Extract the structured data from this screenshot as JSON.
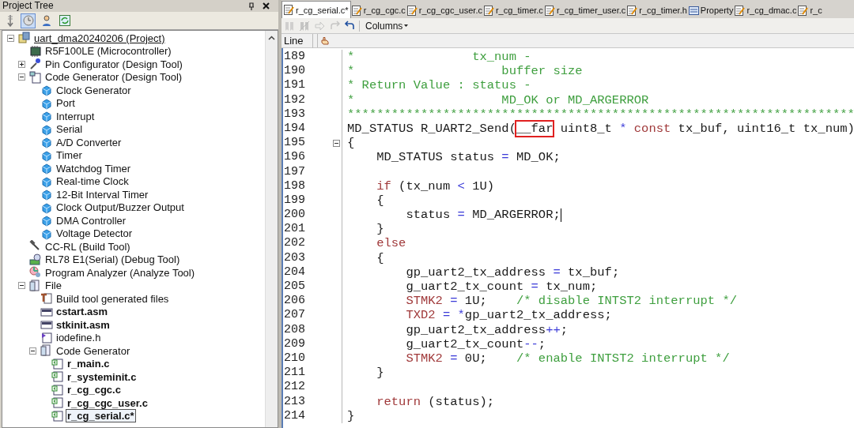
{
  "project_tree": {
    "title": "Project Tree",
    "toolbar": [
      {
        "kind": "sort",
        "selected": false
      },
      {
        "kind": "clock",
        "selected": true
      },
      {
        "kind": "person",
        "selected": false
      },
      {
        "kind": "refresh",
        "selected": false
      }
    ],
    "nodes": [
      {
        "label": "uart_dma20240206 (Project)",
        "kind": "project",
        "expanded": true,
        "bold": false,
        "selected": false,
        "children": [
          {
            "label": "R5F100LE (Microcontroller)",
            "kind": "mcu",
            "bold": false,
            "selected": false
          },
          {
            "label": "Pin Configurator (Design Tool)",
            "kind": "pin",
            "expanded": false,
            "bold": false,
            "selected": false
          },
          {
            "label": "Code Generator (Design Tool)",
            "kind": "codegen",
            "expanded": true,
            "bold": false,
            "selected": false,
            "children": [
              {
                "label": "Clock Generator",
                "kind": "peripheral",
                "bold": false,
                "selected": false
              },
              {
                "label": "Port",
                "kind": "peripheral",
                "bold": false,
                "selected": false
              },
              {
                "label": "Interrupt",
                "kind": "peripheral",
                "bold": false,
                "selected": false
              },
              {
                "label": "Serial",
                "kind": "peripheral",
                "bold": false,
                "selected": false
              },
              {
                "label": "A/D Converter",
                "kind": "peripheral",
                "bold": false,
                "selected": false
              },
              {
                "label": "Timer",
                "kind": "peripheral",
                "bold": false,
                "selected": false
              },
              {
                "label": "Watchdog Timer",
                "kind": "peripheral",
                "bold": false,
                "selected": false
              },
              {
                "label": "Real-time Clock",
                "kind": "peripheral",
                "bold": false,
                "selected": false
              },
              {
                "label": "12-Bit Interval Timer",
                "kind": "peripheral",
                "bold": false,
                "selected": false
              },
              {
                "label": "Clock Output/Buzzer Output",
                "kind": "peripheral",
                "bold": false,
                "selected": false
              },
              {
                "label": "DMA Controller",
                "kind": "peripheral",
                "bold": false,
                "selected": false
              },
              {
                "label": "Voltage Detector",
                "kind": "peripheral",
                "bold": false,
                "selected": false
              }
            ]
          },
          {
            "label": "CC-RL (Build Tool)",
            "kind": "build",
            "bold": false,
            "selected": false
          },
          {
            "label": "RL78 E1(Serial) (Debug Tool)",
            "kind": "debug",
            "bold": false,
            "selected": false
          },
          {
            "label": "Program Analyzer (Analyze Tool)",
            "kind": "analyze",
            "bold": false,
            "selected": false
          },
          {
            "label": "File",
            "kind": "folder",
            "expanded": true,
            "bold": false,
            "selected": false,
            "children": [
              {
                "label": "Build tool generated files",
                "kind": "buildfiles",
                "bold": false,
                "selected": false
              },
              {
                "label": "cstart.asm",
                "kind": "asm",
                "bold": true,
                "selected": false
              },
              {
                "label": "stkinit.asm",
                "kind": "asm",
                "bold": true,
                "selected": false
              },
              {
                "label": "iodefine.h",
                "kind": "header",
                "bold": false,
                "selected": false
              },
              {
                "label": "Code Generator",
                "kind": "folder",
                "expanded": true,
                "bold": false,
                "selected": false,
                "children": [
                  {
                    "label": "r_main.c",
                    "kind": "c",
                    "bold": true,
                    "selected": false
                  },
                  {
                    "label": "r_systeminit.c",
                    "kind": "c",
                    "bold": true,
                    "selected": false
                  },
                  {
                    "label": "r_cg_cgc.c",
                    "kind": "c",
                    "bold": true,
                    "selected": false
                  },
                  {
                    "label": "r_cg_cgc_user.c",
                    "kind": "c",
                    "bold": true,
                    "selected": false
                  },
                  {
                    "label": "r_cg_serial.c*",
                    "kind": "c",
                    "bold": true,
                    "selected": true
                  }
                ]
              }
            ]
          }
        ]
      }
    ]
  },
  "editor": {
    "tabs": [
      {
        "label": "r_cg_serial.c*",
        "kind": "file",
        "selected": true
      },
      {
        "label": "r_cg_cgc.c",
        "kind": "file",
        "selected": false
      },
      {
        "label": "r_cg_cgc_user.c",
        "kind": "file",
        "selected": false
      },
      {
        "label": "r_cg_timer.c",
        "kind": "file",
        "selected": false
      },
      {
        "label": "r_cg_timer_user.c",
        "kind": "file",
        "selected": false
      },
      {
        "label": "r_cg_timer.h",
        "kind": "file",
        "selected": false
      },
      {
        "label": "Property",
        "kind": "property",
        "selected": false
      },
      {
        "label": "r_cg_dmac.c",
        "kind": "file",
        "selected": false
      },
      {
        "label": "r_c",
        "kind": "file",
        "selected": false
      }
    ],
    "toolbar": {
      "columns_label": "Columns",
      "icons": [
        {
          "kind": "bookmark",
          "disabled": true
        },
        {
          "kind": "bookmark-clear",
          "disabled": true
        },
        {
          "kind": "forward",
          "disabled": true
        },
        {
          "kind": "redo",
          "disabled": true
        },
        {
          "kind": "undo",
          "disabled": false
        }
      ]
    },
    "header": {
      "line_label": "Line"
    },
    "lines": [
      {
        "number": "189",
        "fold": false,
        "cursor": false,
        "segments": [
          {
            "text": "*                tx_num -",
            "kind": "comment"
          }
        ]
      },
      {
        "number": "190",
        "fold": false,
        "cursor": false,
        "segments": [
          {
            "text": "*                    buffer size",
            "kind": "comment"
          }
        ]
      },
      {
        "number": "191",
        "fold": false,
        "cursor": false,
        "segments": [
          {
            "text": "* Return Value : status -",
            "kind": "comment"
          }
        ]
      },
      {
        "number": "192",
        "fold": false,
        "cursor": false,
        "segments": [
          {
            "text": "*                    MD_OK or MD_ARGERROR",
            "kind": "comment"
          }
        ]
      },
      {
        "number": "193",
        "fold": false,
        "cursor": false,
        "segments": [
          {
            "text": "*********************************************************************",
            "kind": "comment"
          }
        ]
      },
      {
        "number": "194",
        "fold": false,
        "cursor": false,
        "segments": [
          {
            "text": "MD_STATUS R_UART2_Send(",
            "kind": "plain"
          },
          {
            "text": "__far",
            "kind": "plain",
            "boxed": true
          },
          {
            "text": " uint8_t ",
            "kind": "plain"
          },
          {
            "text": "*",
            "kind": "op"
          },
          {
            "text": " const",
            "kind": "keyword"
          },
          {
            "text": " tx_buf, uint16_t tx_num)",
            "kind": "plain"
          }
        ]
      },
      {
        "number": "195",
        "fold": true,
        "cursor": false,
        "segments": [
          {
            "text": "{",
            "kind": "plain"
          }
        ]
      },
      {
        "number": "196",
        "fold": false,
        "cursor": false,
        "segments": [
          {
            "text": "    MD_STATUS status ",
            "kind": "plain"
          },
          {
            "text": "=",
            "kind": "op"
          },
          {
            "text": " MD_OK;",
            "kind": "plain"
          }
        ]
      },
      {
        "number": "197",
        "fold": false,
        "cursor": false
      },
      {
        "number": "198",
        "fold": false,
        "cursor": false,
        "segments": [
          {
            "text": "    if",
            "kind": "keyword"
          },
          {
            "text": " (tx_num ",
            "kind": "plain"
          },
          {
            "text": "<",
            "kind": "op"
          },
          {
            "text": " 1U)",
            "kind": "plain"
          }
        ]
      },
      {
        "number": "199",
        "fold": false,
        "cursor": false,
        "segments": [
          {
            "text": "    {",
            "kind": "plain"
          }
        ]
      },
      {
        "number": "200",
        "fold": false,
        "cursor": true,
        "segments": [
          {
            "text": "        status ",
            "kind": "plain"
          },
          {
            "text": "=",
            "kind": "op"
          },
          {
            "text": " MD_ARGERROR;",
            "kind": "plain"
          }
        ]
      },
      {
        "number": "201",
        "fold": false,
        "cursor": false,
        "segments": [
          {
            "text": "    }",
            "kind": "plain"
          }
        ]
      },
      {
        "number": "202",
        "fold": false,
        "cursor": false,
        "segments": [
          {
            "text": "    else",
            "kind": "keyword"
          }
        ]
      },
      {
        "number": "203",
        "fold": false,
        "cursor": false,
        "segments": [
          {
            "text": "    {",
            "kind": "plain"
          }
        ]
      },
      {
        "number": "204",
        "fold": false,
        "cursor": false,
        "segments": [
          {
            "text": "        gp_uart2_tx_address ",
            "kind": "plain"
          },
          {
            "text": "=",
            "kind": "op"
          },
          {
            "text": " tx_buf;",
            "kind": "plain"
          }
        ]
      },
      {
        "number": "205",
        "fold": false,
        "cursor": false,
        "segments": [
          {
            "text": "        g_uart2_tx_count ",
            "kind": "plain"
          },
          {
            "text": "=",
            "kind": "op"
          },
          {
            "text": " tx_num;",
            "kind": "plain"
          }
        ]
      },
      {
        "number": "206",
        "fold": false,
        "cursor": false,
        "segments": [
          {
            "text": "        STMK2",
            "kind": "keyword"
          },
          {
            "text": " =",
            "kind": "op"
          },
          {
            "text": " 1U;    ",
            "kind": "plain"
          },
          {
            "text": "/* disable INTST2 interrupt */",
            "kind": "comment"
          }
        ]
      },
      {
        "number": "207",
        "fold": false,
        "cursor": false,
        "segments": [
          {
            "text": "        TXD2",
            "kind": "keyword"
          },
          {
            "text": " = *",
            "kind": "op"
          },
          {
            "text": "gp_uart2_tx_address;",
            "kind": "plain"
          }
        ]
      },
      {
        "number": "208",
        "fold": false,
        "cursor": false,
        "segments": [
          {
            "text": "        gp_uart2_tx_address",
            "kind": "plain"
          },
          {
            "text": "++",
            "kind": "op"
          },
          {
            "text": ";",
            "kind": "plain"
          }
        ]
      },
      {
        "number": "209",
        "fold": false,
        "cursor": false,
        "segments": [
          {
            "text": "        g_uart2_tx_count",
            "kind": "plain"
          },
          {
            "text": "--",
            "kind": "op"
          },
          {
            "text": ";",
            "kind": "plain"
          }
        ]
      },
      {
        "number": "210",
        "fold": false,
        "cursor": false,
        "segments": [
          {
            "text": "        STMK2",
            "kind": "keyword"
          },
          {
            "text": " =",
            "kind": "op"
          },
          {
            "text": " 0U;    ",
            "kind": "plain"
          },
          {
            "text": "/* enable INTST2 interrupt */",
            "kind": "comment"
          }
        ]
      },
      {
        "number": "211",
        "fold": false,
        "cursor": false,
        "segments": [
          {
            "text": "    }",
            "kind": "plain"
          }
        ]
      },
      {
        "number": "212",
        "fold": false,
        "cursor": false
      },
      {
        "number": "213",
        "fold": false,
        "cursor": false,
        "segments": [
          {
            "text": "    return",
            "kind": "keyword"
          },
          {
            "text": " (status);",
            "kind": "plain"
          }
        ]
      },
      {
        "number": "214",
        "fold": false,
        "cursor": false,
        "segments": [
          {
            "text": "}",
            "kind": "plain"
          }
        ]
      }
    ]
  }
}
